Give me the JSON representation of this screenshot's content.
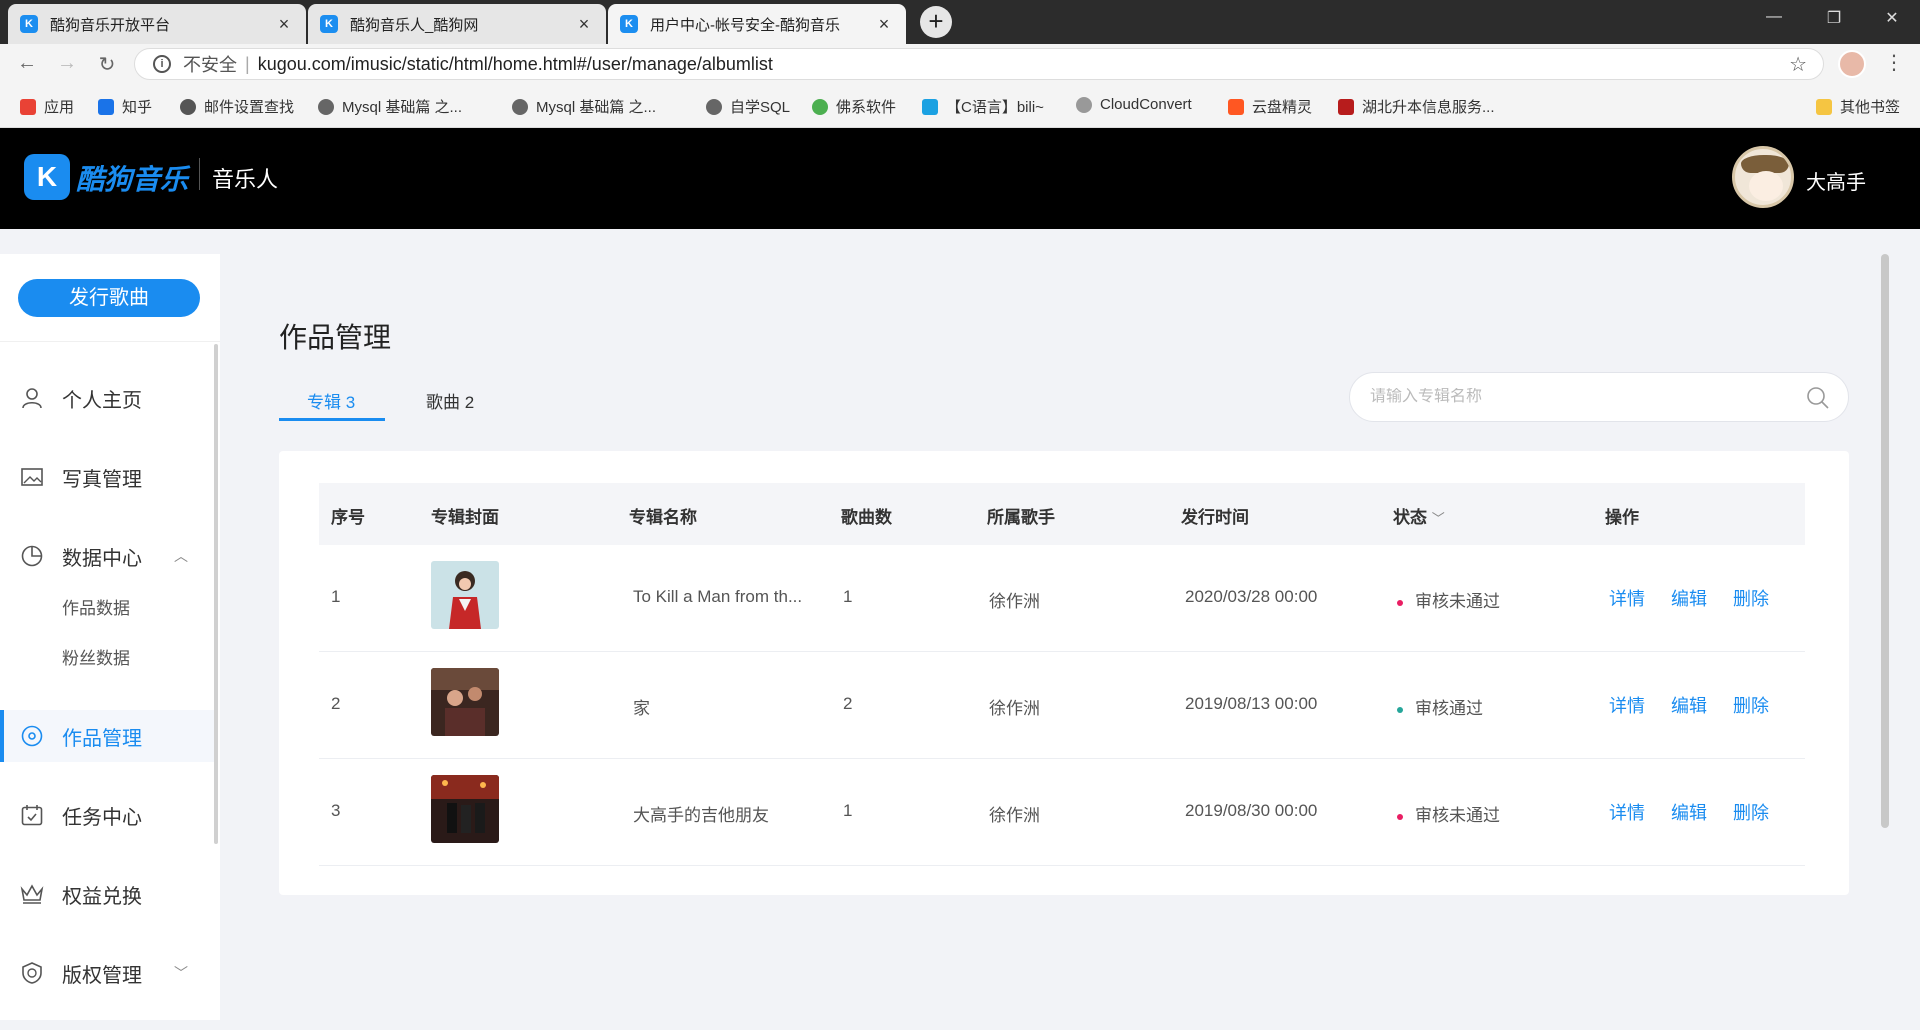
{
  "browser": {
    "tabs": [
      {
        "title": "酷狗音乐开放平台",
        "favicon": "K"
      },
      {
        "title": "酷狗音乐人_酷狗网",
        "favicon": "K"
      },
      {
        "title": "用户中心-帐号安全-酷狗音乐",
        "favicon": "K"
      }
    ],
    "address": {
      "insecure_label": "不安全",
      "separator": "|",
      "url": "kugou.com/imusic/static/html/home.html#/user/manage/albumlist"
    },
    "bookmarks": [
      {
        "label": "应用",
        "color": "#e94235"
      },
      {
        "label": "知乎",
        "color": "#1a73e8"
      },
      {
        "label": "邮件设置查找",
        "color": "#555555"
      },
      {
        "label": "Mysql 基础篇 之...",
        "color": "#555555"
      },
      {
        "label": "Mysql 基础篇 之...",
        "color": "#555555"
      },
      {
        "label": "自学SQL",
        "color": "#555555"
      },
      {
        "label": "佛系软件",
        "color": "#4caf50"
      },
      {
        "label": "【C语言】bili~",
        "color": "#1ba1e2"
      },
      {
        "label": "CloudConvert",
        "color": "#777777"
      },
      {
        "label": "云盘精灵",
        "color": "#ff5722"
      },
      {
        "label": "湖北升本信息服务...",
        "color": "#b71c1c"
      }
    ],
    "other_bookmarks": "其他书签"
  },
  "header": {
    "logo_letter": "K",
    "logo_text": "酷狗音乐",
    "subtitle": "音乐人",
    "user_name": "大高手"
  },
  "sidebar": {
    "publish_button": "发行歌曲",
    "items": [
      {
        "label": "个人主页",
        "icon": "user-icon"
      },
      {
        "label": "写真管理",
        "icon": "image-icon"
      },
      {
        "label": "数据中心",
        "icon": "pie-chart-icon"
      },
      {
        "label": "作品管理",
        "icon": "music-disc-icon"
      },
      {
        "label": "任务中心",
        "icon": "calendar-check-icon"
      },
      {
        "label": "权益兑换",
        "icon": "crown-icon"
      },
      {
        "label": "版权管理",
        "icon": "copyright-icon"
      }
    ],
    "sub_items": [
      "作品数据",
      "粉丝数据"
    ],
    "active": "作品管理"
  },
  "main": {
    "title": "作品管理",
    "tabs": [
      "专辑 3",
      "歌曲 2"
    ],
    "search_placeholder": "请输入专辑名称",
    "columns": [
      "序号",
      "专辑封面",
      "专辑名称",
      "歌曲数",
      "所属歌手",
      "发行时间",
      "状态",
      "操作"
    ],
    "rows": [
      {
        "index": "1",
        "name": "To Kill a Man from th...",
        "count": "1",
        "singer": "徐作洲",
        "date": "2020/03/28 00:00",
        "status": "审核未通过",
        "status_color": "#e91e63"
      },
      {
        "index": "2",
        "name": "家",
        "count": "2",
        "singer": "徐作洲",
        "date": "2019/08/13 00:00",
        "status": "审核通过",
        "status_color": "#26a69a"
      },
      {
        "index": "3",
        "name": "大高手的吉他朋友",
        "count": "1",
        "singer": "徐作洲",
        "date": "2019/08/30 00:00",
        "status": "审核未通过",
        "status_color": "#e91e63"
      }
    ],
    "actions": {
      "detail": "详情",
      "edit": "编辑",
      "delete": "删除"
    }
  },
  "colors": {
    "accent": "#1a8cf0",
    "header_bg": "#000000",
    "page_bg": "#f2f3f7"
  }
}
